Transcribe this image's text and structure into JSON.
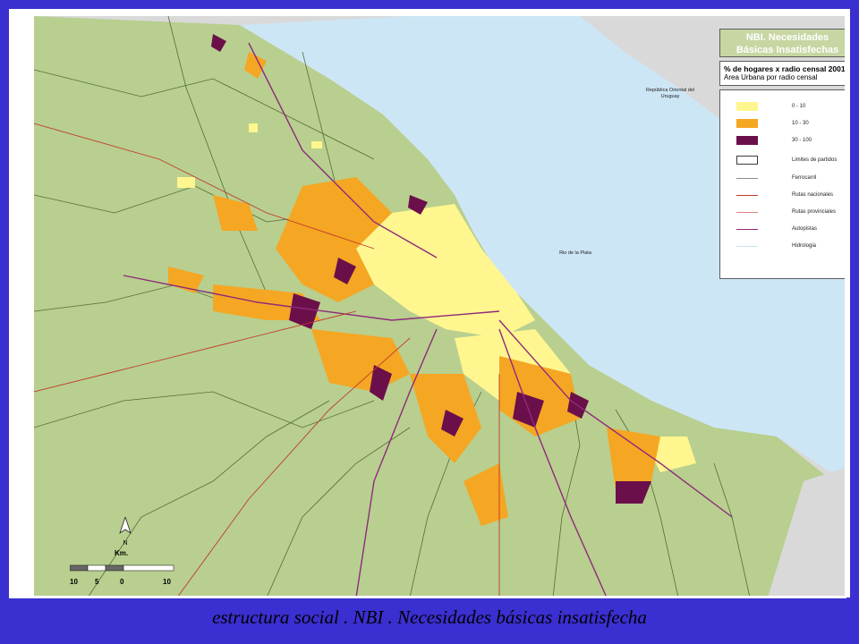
{
  "caption": "estructura social . NBI . Necesidades básicas insatisfecha",
  "legend": {
    "title_line1": "NBI. Necesidades",
    "title_line2": "Básicas Insatisfechas",
    "subtitle_line1": "% de hogares x radio censal 2001",
    "subtitle_line2": "Area Urbana por radio censal",
    "items": [
      {
        "label": "0 - 10",
        "color": "#fff68f",
        "kind": "fill"
      },
      {
        "label": "10 - 30",
        "color": "#f5a623",
        "kind": "fill"
      },
      {
        "label": "30 - 100",
        "color": "#6b0f4a",
        "kind": "fill"
      },
      {
        "label": "Limites de partidos",
        "color": "#3c3c3c",
        "kind": "outline"
      },
      {
        "label": "Ferrocarril",
        "color": "#8a8a8a",
        "kind": "line"
      },
      {
        "label": "Rutas nacionales",
        "color": "#c0392b",
        "kind": "line"
      },
      {
        "label": "Rutas provinciales",
        "color": "#e08080",
        "kind": "line"
      },
      {
        "label": "Autopistas",
        "color": "#8e2a7a",
        "kind": "line"
      },
      {
        "label": "Hidrologia",
        "color": "#c9e4f2",
        "kind": "line"
      }
    ]
  },
  "map_labels": {
    "uruguay": "República Oriental del Uruguay",
    "river": "Rio de la Plata"
  },
  "scale": {
    "unit": "Km.",
    "north": "N",
    "ticks": [
      "10",
      "5",
      "0",
      "10"
    ]
  },
  "colors": {
    "land": "#b8cf8f",
    "water": "#cde6f6",
    "neighbor": "#d9d9d9",
    "nbi_low": "#fff68f",
    "nbi_mid": "#f5a623",
    "nbi_high": "#6b0f4a"
  }
}
